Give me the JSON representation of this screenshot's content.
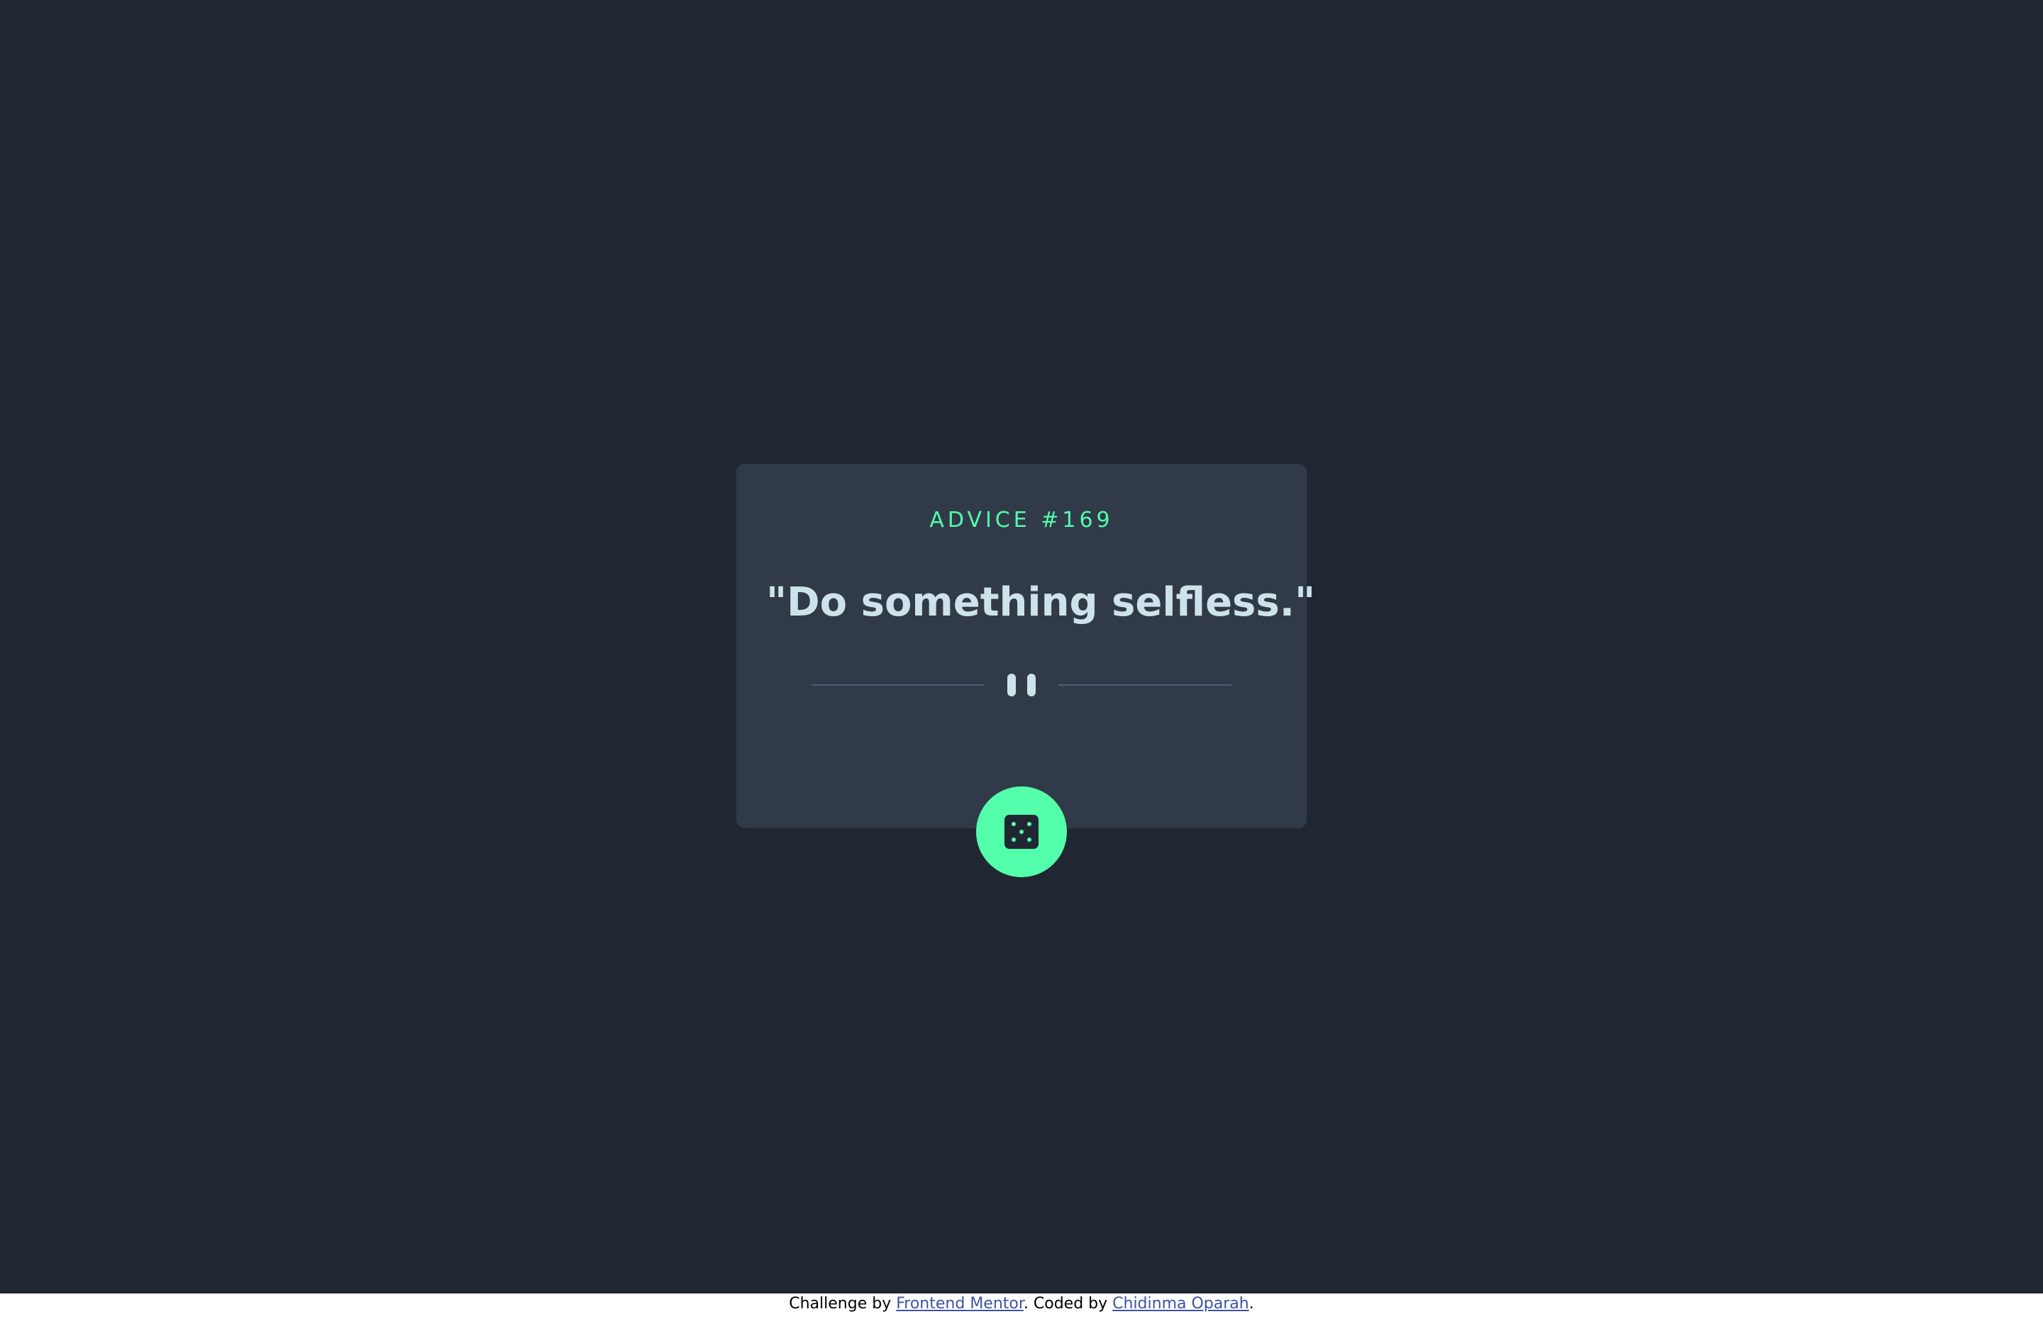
{
  "advice": {
    "label": "ADVICE #169",
    "quote": "\"Do something selfless.\""
  },
  "controls": {
    "dice_button_icon": "dice-icon",
    "divider_icon": "pause-icon"
  },
  "attribution": {
    "prefix": "Challenge by ",
    "frontend_mentor_link": "Frontend Mentor",
    "middle": ". Coded by ",
    "author_link": "Chidinma Oparah",
    "suffix": "."
  },
  "colors": {
    "background": "#202733",
    "card": "#313a48",
    "accent": "#53ffaa",
    "quote_text": "#cee3e9",
    "divider": "#4f5d74",
    "link": "#3e52a3"
  }
}
